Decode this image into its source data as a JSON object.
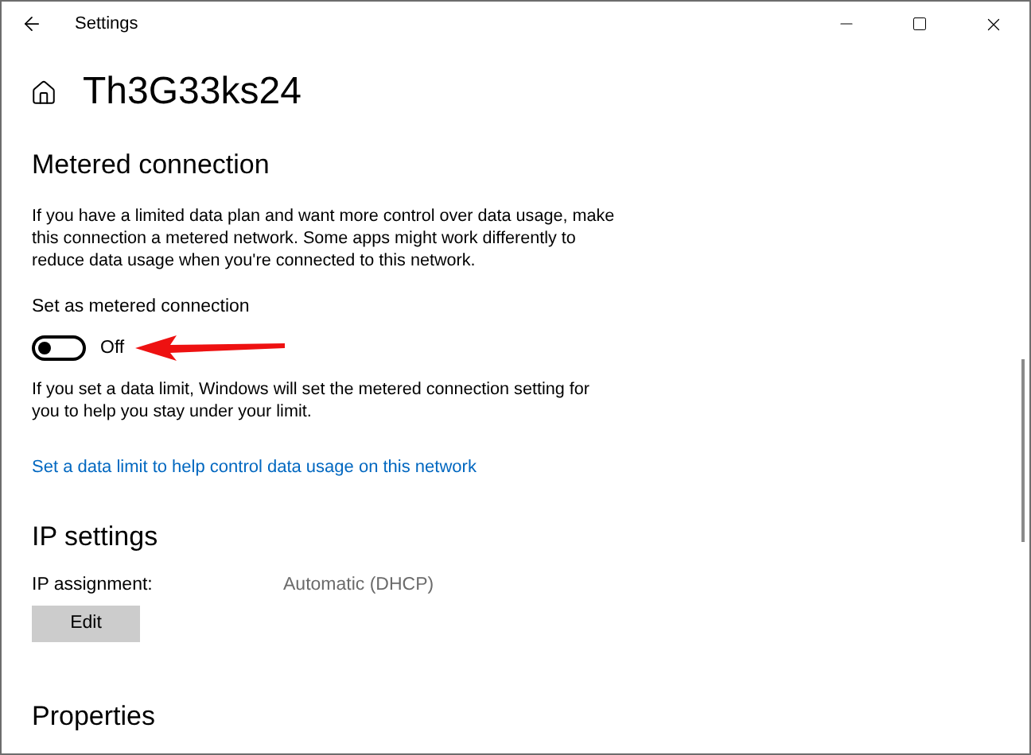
{
  "window": {
    "title": "Settings"
  },
  "page_title": "Th3G33ks24",
  "metered": {
    "heading": "Metered connection",
    "description": "If you have a limited data plan and want more control over data usage, make this connection a metered network. Some apps might work differently to reduce data usage when you're connected to this network.",
    "toggle_label": "Set as metered connection",
    "toggle": {
      "on": false,
      "state_text": "Off"
    },
    "limit_note": "If you set a data limit, Windows will set the metered connection setting for you to help you stay under your limit.",
    "link": "Set a data limit to help control data usage on this network"
  },
  "ip_settings": {
    "heading": "IP settings",
    "label": "IP assignment:",
    "value": "Automatic (DHCP)",
    "button": "Edit"
  },
  "properties": {
    "heading": "Properties"
  }
}
